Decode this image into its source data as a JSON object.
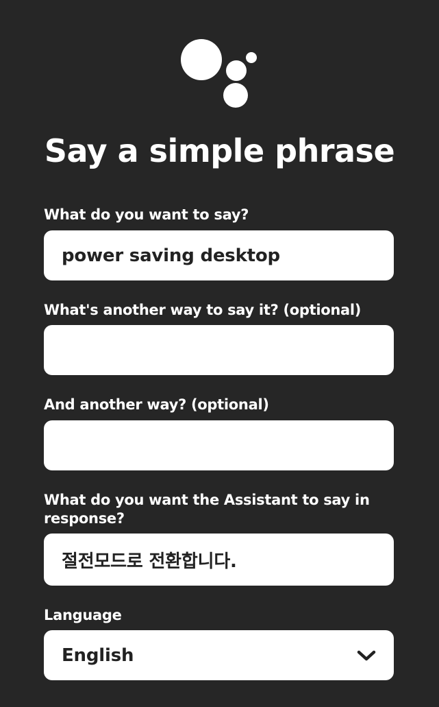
{
  "header": {
    "title": "Say a simple phrase",
    "logo_icon": "assistant-dots-icon"
  },
  "fields": {
    "phrase": {
      "label": "What do you want to say?",
      "value": "power saving desktop"
    },
    "alt_phrase_1": {
      "label": "What's another way to say it? (optional)",
      "value": ""
    },
    "alt_phrase_2": {
      "label": "And another way? (optional)",
      "value": ""
    },
    "response": {
      "label": "What do you want the Assistant to say in response?",
      "value": "절전모드로 전환합니다."
    },
    "language": {
      "label": "Language",
      "selected": "English",
      "icon": "chevron-down-icon"
    }
  },
  "colors": {
    "background": "#262626",
    "field_background": "#ffffff",
    "text_light": "#ffffff",
    "text_dark": "#222222"
  }
}
